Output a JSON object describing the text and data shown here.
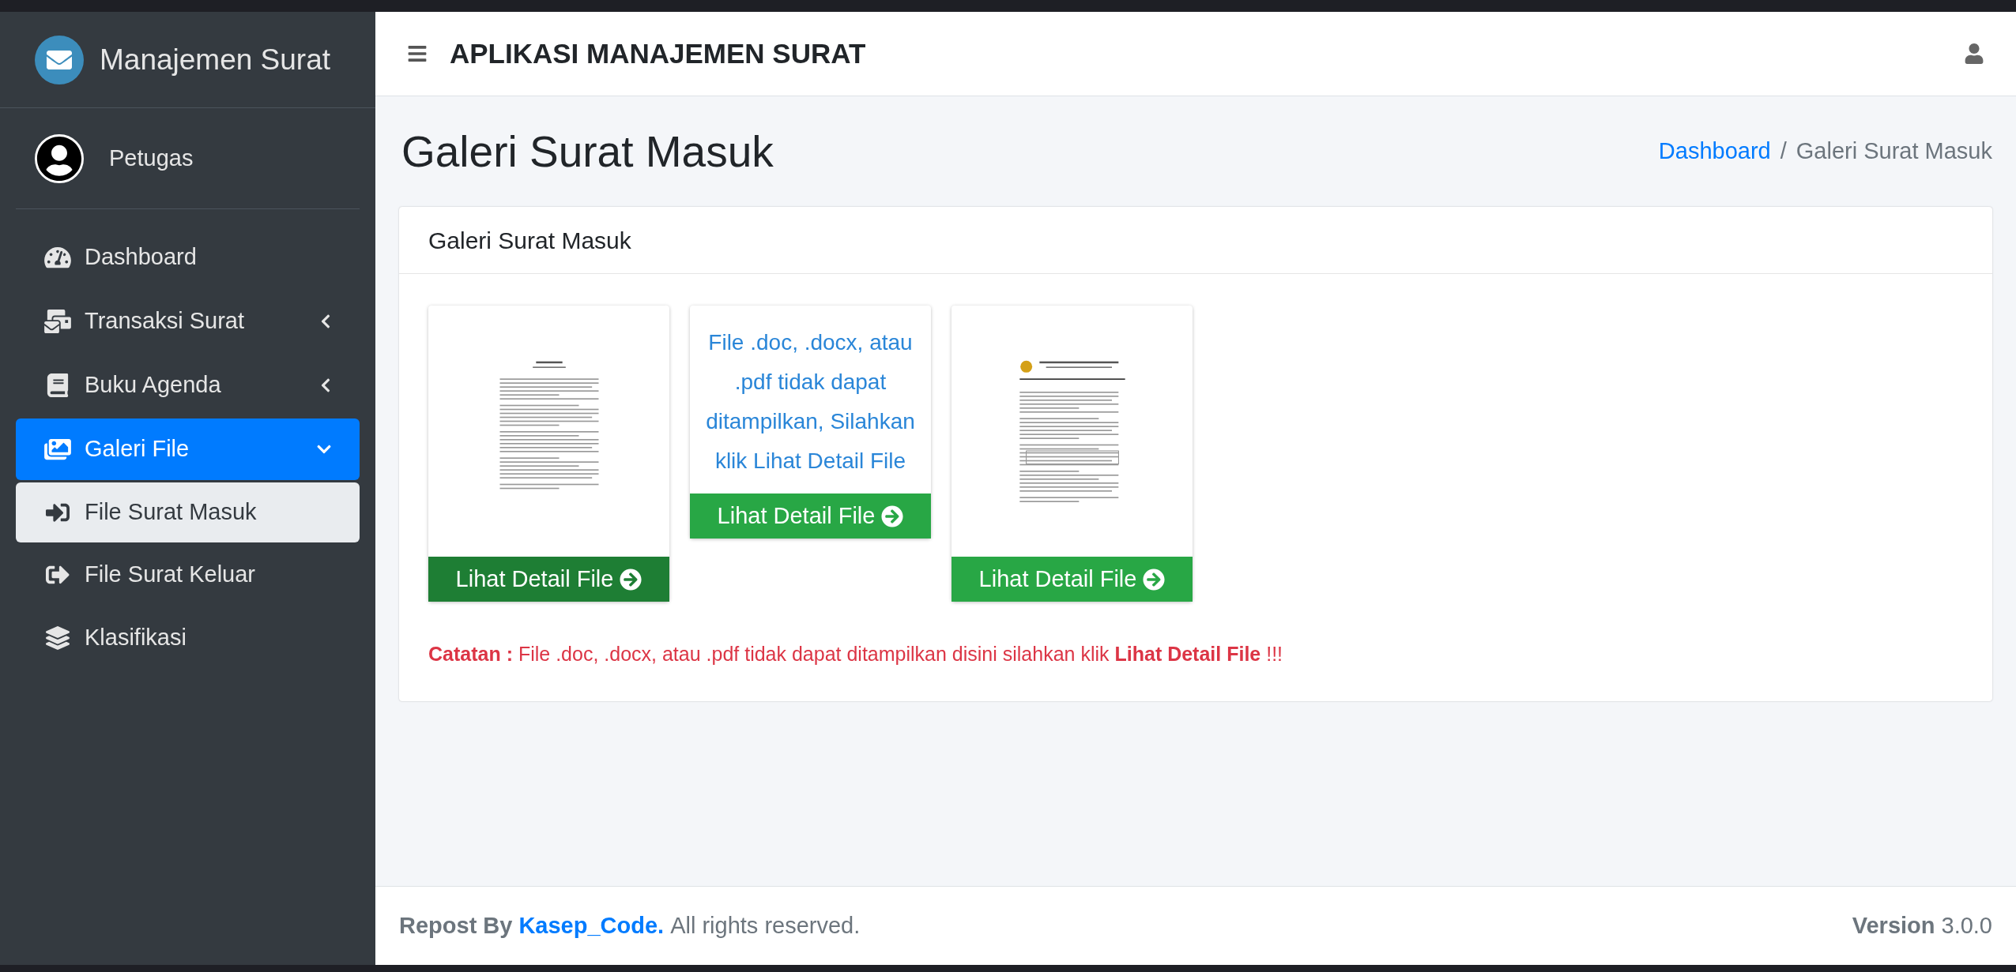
{
  "sidebar": {
    "brand": "Manajemen Surat",
    "user": "Petugas",
    "items": [
      {
        "label": "Dashboard",
        "active": false
      },
      {
        "label": "Transaksi Surat",
        "has_submenu": true,
        "expanded": false,
        "active": false
      },
      {
        "label": "Buku Agenda",
        "has_submenu": true,
        "expanded": false,
        "active": false
      },
      {
        "label": "Galeri File",
        "has_submenu": true,
        "expanded": true,
        "active": true,
        "children": [
          {
            "label": "File Surat Masuk",
            "selected": true
          },
          {
            "label": "File Surat Keluar",
            "selected": false
          }
        ]
      },
      {
        "label": "Klasifikasi",
        "active": false
      }
    ]
  },
  "header": {
    "title": "APLIKASI MANAJEMEN SURAT"
  },
  "page": {
    "title": "Galeri Surat Masuk",
    "breadcrumb": [
      {
        "label": "Dashboard",
        "link": true
      },
      {
        "label": "Galeri Surat Masuk",
        "link": false
      }
    ],
    "breadcrumb_separator": "/"
  },
  "card": {
    "title": "Galeri Surat Masuk",
    "files": [
      {
        "kind": "letter",
        "button": "Lihat Detail File",
        "hovered": true
      },
      {
        "kind": "message",
        "message": "File .doc, .docx, atau .pdf tidak dapat ditampilkan, Silahkan klik Lihat Detail File",
        "button": "Lihat Detail File",
        "hovered": false
      },
      {
        "kind": "letterhead",
        "button": "Lihat Detail File",
        "hovered": false
      }
    ],
    "note": "**Catatan :** File .doc, .docx, atau .pdf tidak dapat ditampilkan disini silahkan klik **Lihat Detail File** !!!"
  },
  "footer": {
    "prefix": "Repost By",
    "link": "Kasep_Code.",
    "suffix": "All rights reserved.",
    "version_label": "Version",
    "version": "3.0.0"
  }
}
